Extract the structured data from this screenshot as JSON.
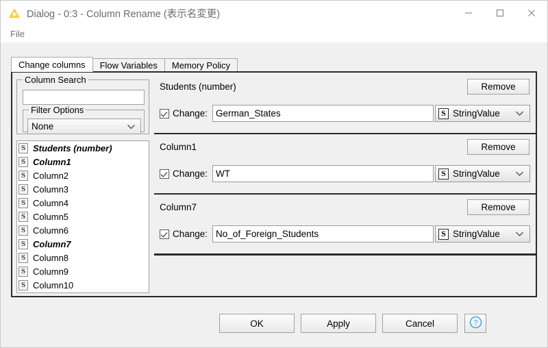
{
  "window": {
    "icon": "knime-triangle-icon",
    "title": "Dialog - 0:3 - Column Rename (表示名変更)",
    "minimize_label": "Minimize",
    "maximize_label": "Maximize",
    "close_label": "Close"
  },
  "menubar": {
    "items": [
      {
        "label": "File",
        "name": "menu-file"
      }
    ]
  },
  "tabs": [
    {
      "label": "Change columns",
      "active": true
    },
    {
      "label": "Flow Variables",
      "active": false
    },
    {
      "label": "Memory Policy",
      "active": false
    }
  ],
  "left_pane": {
    "search_group": {
      "title": "Column Search",
      "input_value": "",
      "input_placeholder": ""
    },
    "filter_group": {
      "title": "Filter Options",
      "selected": "None"
    },
    "column_list": [
      {
        "icon": "string-type-icon",
        "label": "Students (number)",
        "modified": true
      },
      {
        "icon": "string-type-icon",
        "label": "Column1",
        "modified": true
      },
      {
        "icon": "string-type-icon",
        "label": "Column2",
        "modified": false
      },
      {
        "icon": "string-type-icon",
        "label": "Column3",
        "modified": false
      },
      {
        "icon": "string-type-icon",
        "label": "Column4",
        "modified": false
      },
      {
        "icon": "string-type-icon",
        "label": "Column5",
        "modified": false
      },
      {
        "icon": "string-type-icon",
        "label": "Column6",
        "modified": false
      },
      {
        "icon": "string-type-icon",
        "label": "Column7",
        "modified": true
      },
      {
        "icon": "string-type-icon",
        "label": "Column8",
        "modified": false
      },
      {
        "icon": "string-type-icon",
        "label": "Column9",
        "modified": false
      },
      {
        "icon": "string-type-icon",
        "label": "Column10",
        "modified": false
      }
    ]
  },
  "rename_panels": [
    {
      "source_column": "Students (number)",
      "remove_label": "Remove",
      "change_checked": true,
      "change_label": "Change:",
      "new_name": "German_States",
      "type_icon": "string-type-icon",
      "type_value": "StringValue"
    },
    {
      "source_column": "Column1",
      "remove_label": "Remove",
      "change_checked": true,
      "change_label": "Change:",
      "new_name": "WT",
      "type_icon": "string-type-icon",
      "type_value": "StringValue"
    },
    {
      "source_column": "Column7",
      "remove_label": "Remove",
      "change_checked": true,
      "change_label": "Change:",
      "new_name": "No_of_Foreign_Students",
      "type_icon": "string-type-icon",
      "type_value": "StringValue"
    }
  ],
  "footer": {
    "ok_label": "OK",
    "apply_label": "Apply",
    "cancel_label": "Cancel",
    "help_label": "?",
    "help_icon": "help-circle-icon"
  },
  "colors": {
    "accent_icon_yellow": "#FFCC33",
    "help_blue": "#3DA5E0",
    "frame_dark": "#2b2b2b",
    "window_bg": "#f0f0f0"
  }
}
